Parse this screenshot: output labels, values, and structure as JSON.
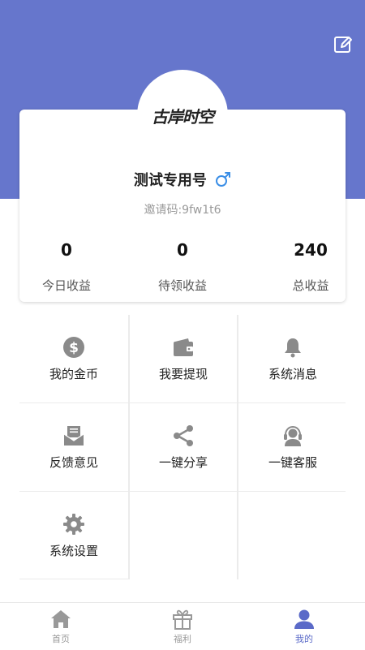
{
  "header": {
    "edit_icon": "edit-icon",
    "bg_color": "#6676cc"
  },
  "profile": {
    "avatar_logo_text": "古岸时空",
    "username": "测试专用号",
    "gender_icon": "male-icon",
    "gender_symbol": "♂",
    "invite_code": "邀请码:9fw1t6",
    "stats": [
      {
        "value": "0",
        "label": "今日收益"
      },
      {
        "value": "0",
        "label": "待领收益"
      },
      {
        "value": "240",
        "label": "总收益"
      }
    ]
  },
  "menu": [
    {
      "label": "我的金币",
      "icon": "dollar-coin-icon"
    },
    {
      "label": "我要提现",
      "icon": "wallet-icon"
    },
    {
      "label": "系统消息",
      "icon": "bell-icon"
    },
    {
      "label": "反馈意见",
      "icon": "mail-icon"
    },
    {
      "label": "一键分享",
      "icon": "share-icon"
    },
    {
      "label": "一键客服",
      "icon": "headset-icon"
    },
    {
      "label": "系统设置",
      "icon": "gear-icon"
    }
  ],
  "bottom_nav": [
    {
      "label": "首页",
      "icon": "home-icon",
      "active": false
    },
    {
      "label": "福利",
      "icon": "gift-icon",
      "active": false
    },
    {
      "label": "我的",
      "icon": "user-icon",
      "active": true
    }
  ],
  "colors": {
    "accent": "#5b6ac8",
    "icon_gray": "#8a8a8a"
  }
}
